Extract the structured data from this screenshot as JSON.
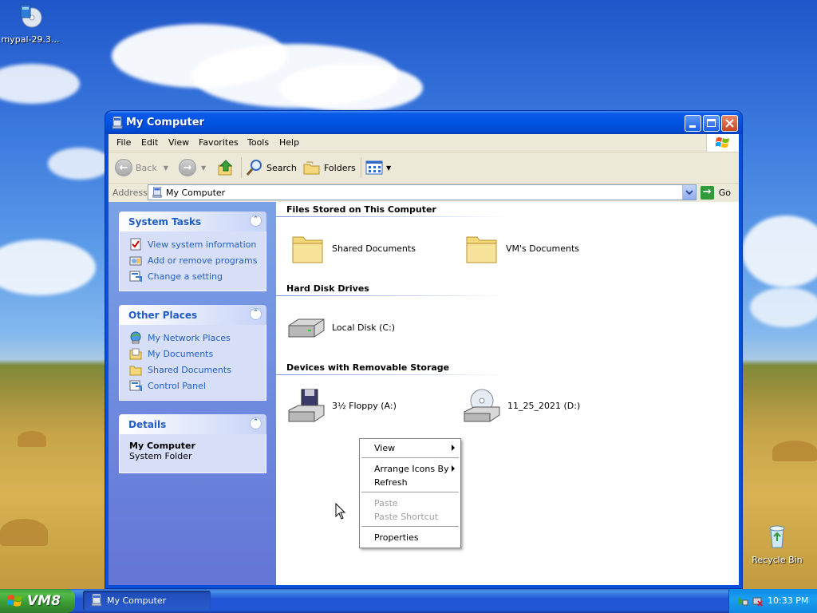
{
  "desktop": {
    "icons": [
      {
        "label": "mypal-29.3...",
        "icon": "installer-disc-icon"
      },
      {
        "label": "Recycle Bin",
        "icon": "recycle-bin-icon"
      }
    ]
  },
  "window": {
    "title": "My Computer",
    "menu": [
      "File",
      "Edit",
      "View",
      "Favorites",
      "Tools",
      "Help"
    ],
    "toolbar": {
      "back_label": "Back",
      "search_label": "Search",
      "folders_label": "Folders"
    },
    "address": {
      "label": "Address",
      "value": "My Computer",
      "go_label": "Go"
    }
  },
  "sidebar": {
    "system_tasks": {
      "title": "System Tasks",
      "items": [
        {
          "label": "View system information",
          "icon": "system-info-icon"
        },
        {
          "label": "Add or remove programs",
          "icon": "add-remove-programs-icon"
        },
        {
          "label": "Change a setting",
          "icon": "control-panel-icon"
        }
      ]
    },
    "other_places": {
      "title": "Other Places",
      "items": [
        {
          "label": "My Network Places",
          "icon": "network-places-icon"
        },
        {
          "label": "My Documents",
          "icon": "my-documents-icon"
        },
        {
          "label": "Shared Documents",
          "icon": "folder-icon"
        },
        {
          "label": "Control Panel",
          "icon": "control-panel-icon"
        }
      ]
    },
    "details": {
      "title": "Details",
      "name": "My Computer",
      "type": "System Folder"
    }
  },
  "content": {
    "groups": [
      {
        "title": "Files Stored on This Computer",
        "items": [
          {
            "label": "Shared Documents",
            "icon": "folder-icon"
          },
          {
            "label": "VM's Documents",
            "icon": "folder-icon"
          }
        ]
      },
      {
        "title": "Hard Disk Drives",
        "items": [
          {
            "label": "Local Disk (C:)",
            "icon": "hard-disk-icon"
          }
        ]
      },
      {
        "title": "Devices with Removable Storage",
        "items": [
          {
            "label": "3½ Floppy (A:)",
            "icon": "floppy-drive-icon"
          },
          {
            "label": "11_25_2021 (D:)",
            "icon": "cd-drive-icon"
          }
        ]
      }
    ]
  },
  "context_menu": {
    "items": [
      {
        "label": "View",
        "submenu": true,
        "enabled": true
      },
      {
        "label": "Arrange Icons By",
        "submenu": true,
        "enabled": true
      },
      {
        "label": "Refresh",
        "submenu": false,
        "enabled": true
      },
      {
        "label": "Paste",
        "submenu": false,
        "enabled": false
      },
      {
        "label": "Paste Shortcut",
        "submenu": false,
        "enabled": false
      },
      {
        "label": "Properties",
        "submenu": false,
        "enabled": true
      }
    ]
  },
  "taskbar": {
    "start_label": "VM8",
    "window_button_label": "My Computer",
    "clock": "10:33 PM"
  },
  "colors": {
    "titlebar": "#0054e3",
    "link": "#215dc6",
    "taskbar": "#2157d7",
    "start": "#3a9a34"
  }
}
